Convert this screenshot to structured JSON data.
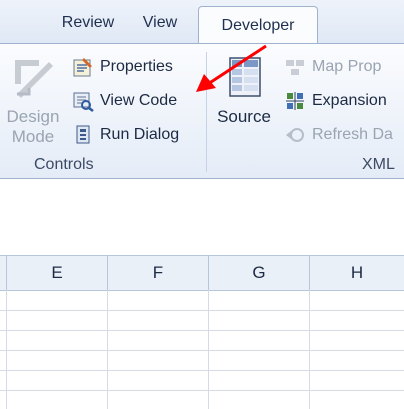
{
  "tabs": [
    {
      "label": "Review"
    },
    {
      "label": "View"
    },
    {
      "label": "Developer"
    }
  ],
  "ribbon": {
    "controls": {
      "design_mode": "Design\nMode",
      "design_mode_line1": "Design",
      "design_mode_line2": "Mode",
      "properties": "Properties",
      "view_code": "View Code",
      "run_dialog": "Run Dialog",
      "group_label": "Controls"
    },
    "xml": {
      "source": "Source",
      "map_properties": "Map Prop",
      "expansion_packs": "Expansion",
      "refresh_data": "Refresh Da",
      "group_label": "XML"
    }
  },
  "sheet": {
    "columns": [
      "E",
      "F",
      "G",
      "H"
    ]
  },
  "colors": {
    "accent": "#ff0000",
    "tab_text": "#1f3050",
    "disabled": "#9aa4b2"
  }
}
